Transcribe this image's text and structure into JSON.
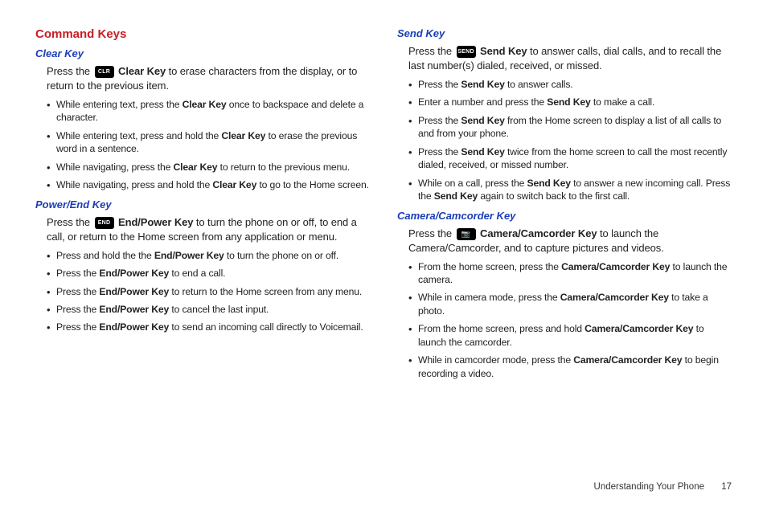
{
  "left": {
    "heading": "Command Keys",
    "clear": {
      "title": "Clear Key",
      "icon": "CLR",
      "intro_pre": "Press the ",
      "intro_key": "Clear Key",
      "intro_post": " to erase characters from the display, or to return to the previous item.",
      "bullets": [
        {
          "pre": "While entering text, press the ",
          "key": "Clear Key",
          "post": " once to backspace and delete a character."
        },
        {
          "pre": "While entering text, press and hold the ",
          "key": "Clear Key",
          "post": " to erase the previous word in a sentence."
        },
        {
          "pre": "While navigating, press the ",
          "key": "Clear Key",
          "post": " to return to the previous menu."
        },
        {
          "pre": "While navigating, press and hold the ",
          "key": "Clear Key",
          "post": " to go to the Home screen."
        }
      ]
    },
    "power": {
      "title": "Power/End Key",
      "icon": "END",
      "intro_pre": "Press the ",
      "intro_key": "End/Power Key",
      "intro_post": " to turn the phone on or off, to end a call, or return to the Home screen from any application or menu.",
      "bullets": [
        {
          "pre": "Press and hold the the ",
          "key": "End/Power Key",
          "post": " to turn the phone on or off."
        },
        {
          "pre": "Press the ",
          "key": "End/Power Key",
          "post": " to end a call."
        },
        {
          "pre": "Press the ",
          "key": "End/Power Key",
          "post": " to return to the Home screen from any menu."
        },
        {
          "pre": "Press the ",
          "key": "End/Power Key",
          "post": " to cancel the last input."
        },
        {
          "pre": "Press the ",
          "key": "End/Power Key",
          "post": " to send an incoming call directly to Voicemail."
        }
      ]
    }
  },
  "right": {
    "send": {
      "title": "Send Key",
      "icon": "SEND",
      "intro_pre": "Press the ",
      "intro_key": "Send Key",
      "intro_post": "  to answer calls, dial calls, and to recall the last number(s) dialed, received, or missed.",
      "bullets": [
        {
          "pre": "Press the ",
          "key": "Send Key",
          "post": " to answer calls."
        },
        {
          "pre": "Enter a number and press the ",
          "key": "Send Key",
          "post": " to make a call."
        },
        {
          "pre": "Press the ",
          "key": "Send Key",
          "post": " from the Home screen to display a list of all calls to and from your phone."
        },
        {
          "pre": "Press the ",
          "key": "Send Key",
          "post": " twice from the home screen to call the most recently dialed, received, or missed number."
        },
        {
          "pre": "While on a call, press the ",
          "key": "Send Key",
          "post": " to answer a new incoming call. Press the ",
          "key2": "Send Key",
          "post2": " again to switch back to the first call."
        }
      ]
    },
    "camera": {
      "title": "Camera/Camcorder Key",
      "icon": "📷",
      "intro_pre": "Press the ",
      "intro_key": "Camera/Camcorder Key",
      "intro_post": " to launch the Camera/Camcorder, and to capture pictures and videos.",
      "bullets": [
        {
          "pre": "From the home screen, press the ",
          "key": "Camera/Camcorder Key",
          "post": " to launch the camera."
        },
        {
          "pre": "While in camera mode, press the ",
          "key": "Camera/Camcorder Key",
          "post": " to take a photo."
        },
        {
          "pre": "From the home screen, press and hold ",
          "key": "Camera/Camcorder Key",
          "post": "  to launch the camcorder."
        },
        {
          "pre": "While in camcorder mode, press the ",
          "key": "Camera/Camcorder Key",
          "post": " to begin recording a video."
        }
      ]
    }
  },
  "footer": {
    "section": "Understanding Your Phone",
    "page": "17"
  }
}
